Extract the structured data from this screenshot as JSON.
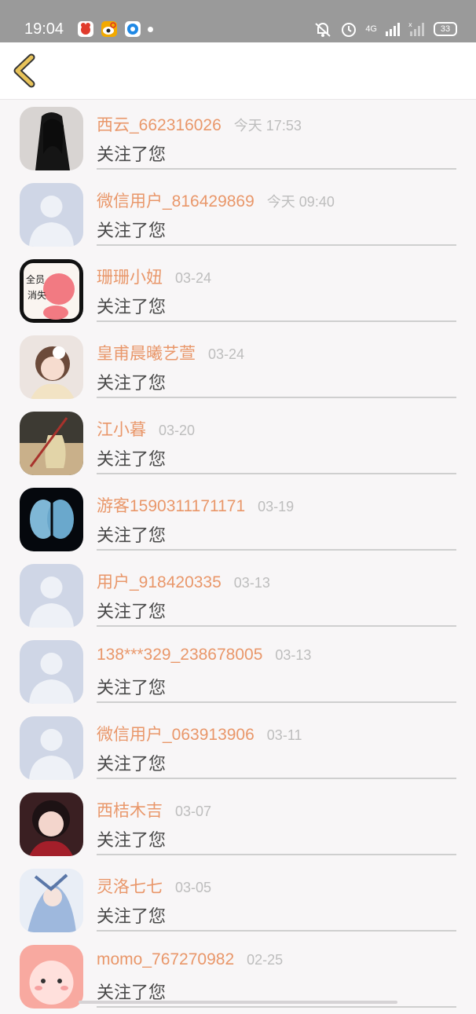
{
  "status_bar": {
    "time": "19:04",
    "network": "4G",
    "battery": "33",
    "notification_icons": [
      "app-red-icon",
      "weibo-icon",
      "blue-circle-icon"
    ]
  },
  "header": {
    "back_icon": "back-chevron-icon"
  },
  "colors": {
    "name": "#e9976a",
    "time": "#bdbdbd",
    "message": "#4a4a4a",
    "back_chevron": "#e8c35a"
  },
  "items": [
    {
      "name": "西云_662316026",
      "time": "今天 17:53",
      "message": "关注了您",
      "avatar": "photo-dark"
    },
    {
      "name": "微信用户_816429869",
      "time": "今天 09:40",
      "message": "关注了您",
      "avatar": "default"
    },
    {
      "name": "珊珊小妞",
      "time": "03-24",
      "message": "关注了您",
      "avatar": "cartoon-pink"
    },
    {
      "name": "皇甫晨曦艺萱",
      "time": "03-24",
      "message": "关注了您",
      "avatar": "photo-girl"
    },
    {
      "name": "江小暮",
      "time": "03-20",
      "message": "关注了您",
      "avatar": "vase"
    },
    {
      "name": "游客1590311171171",
      "time": "03-19",
      "message": "关注了您",
      "avatar": "brain"
    },
    {
      "name": "用户_918420335",
      "time": "03-13",
      "message": "关注了您",
      "avatar": "default"
    },
    {
      "name": "138***329_238678005",
      "time": "03-13",
      "message": "关注了您",
      "avatar": "default"
    },
    {
      "name": "微信用户_063913906",
      "time": "03-11",
      "message": "关注了您",
      "avatar": "default"
    },
    {
      "name": "西桔木吉",
      "time": "03-07",
      "message": "关注了您",
      "avatar": "photo-girl2"
    },
    {
      "name": "灵洛七七",
      "time": "03-05",
      "message": "关注了您",
      "avatar": "anime"
    },
    {
      "name": "momo_767270982",
      "time": "02-25",
      "message": "关注了您",
      "avatar": "cartoon-face"
    }
  ]
}
